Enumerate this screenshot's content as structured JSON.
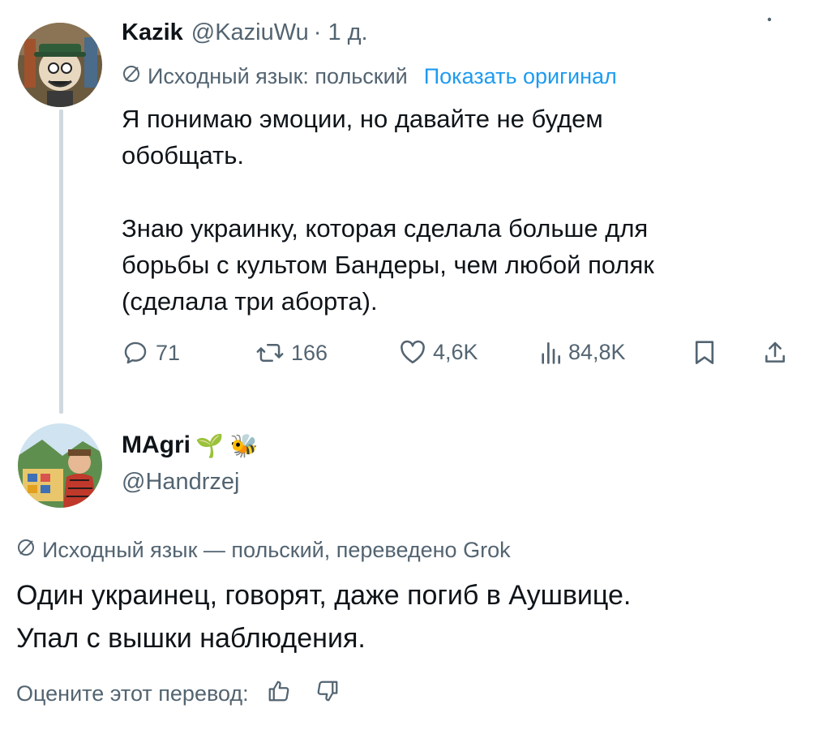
{
  "tweet": {
    "author_name": "Kazik",
    "author_handle": "@KaziuWu",
    "time": "· 1 д.",
    "translation_note": "Исходный язык: польский",
    "show_original": "Показать оригинал",
    "body_line1": "Я понимаю эмоции, но давайте не будем",
    "body_line2": "обобщать.",
    "body_line3": "Знаю украинку, которая сделала больше для",
    "body_line4": "борьбы с культом Бандеры, чем любой поляк",
    "body_line5": "(сделала три аборта).",
    "stats": {
      "replies": "71",
      "retweets": "166",
      "likes": "4,6K",
      "views": "84,8K"
    },
    "icons": [
      "reply-icon",
      "retweet-icon",
      "like-icon",
      "views-icon",
      "bookmark-icon",
      "share-icon",
      "more-icon"
    ]
  },
  "reply": {
    "author_name": "MAgri",
    "author_emoji": "🌱 🐝",
    "author_handle": "@Handrzej",
    "translation_note": "Исходный язык — польский, переведено Grok",
    "body_line1": "Один украинец, говорят, даже погиб в Аушвице.",
    "body_line2": "Упал с вышки наблюдения.",
    "rate_label": "Оцените этот перевод:",
    "icons": [
      "thumbs-up-icon",
      "thumbs-down-icon"
    ]
  },
  "colors": {
    "text": "#0f1419",
    "muted": "#536471",
    "link": "#1d9bf0",
    "thread_line": "#cfd9de"
  }
}
